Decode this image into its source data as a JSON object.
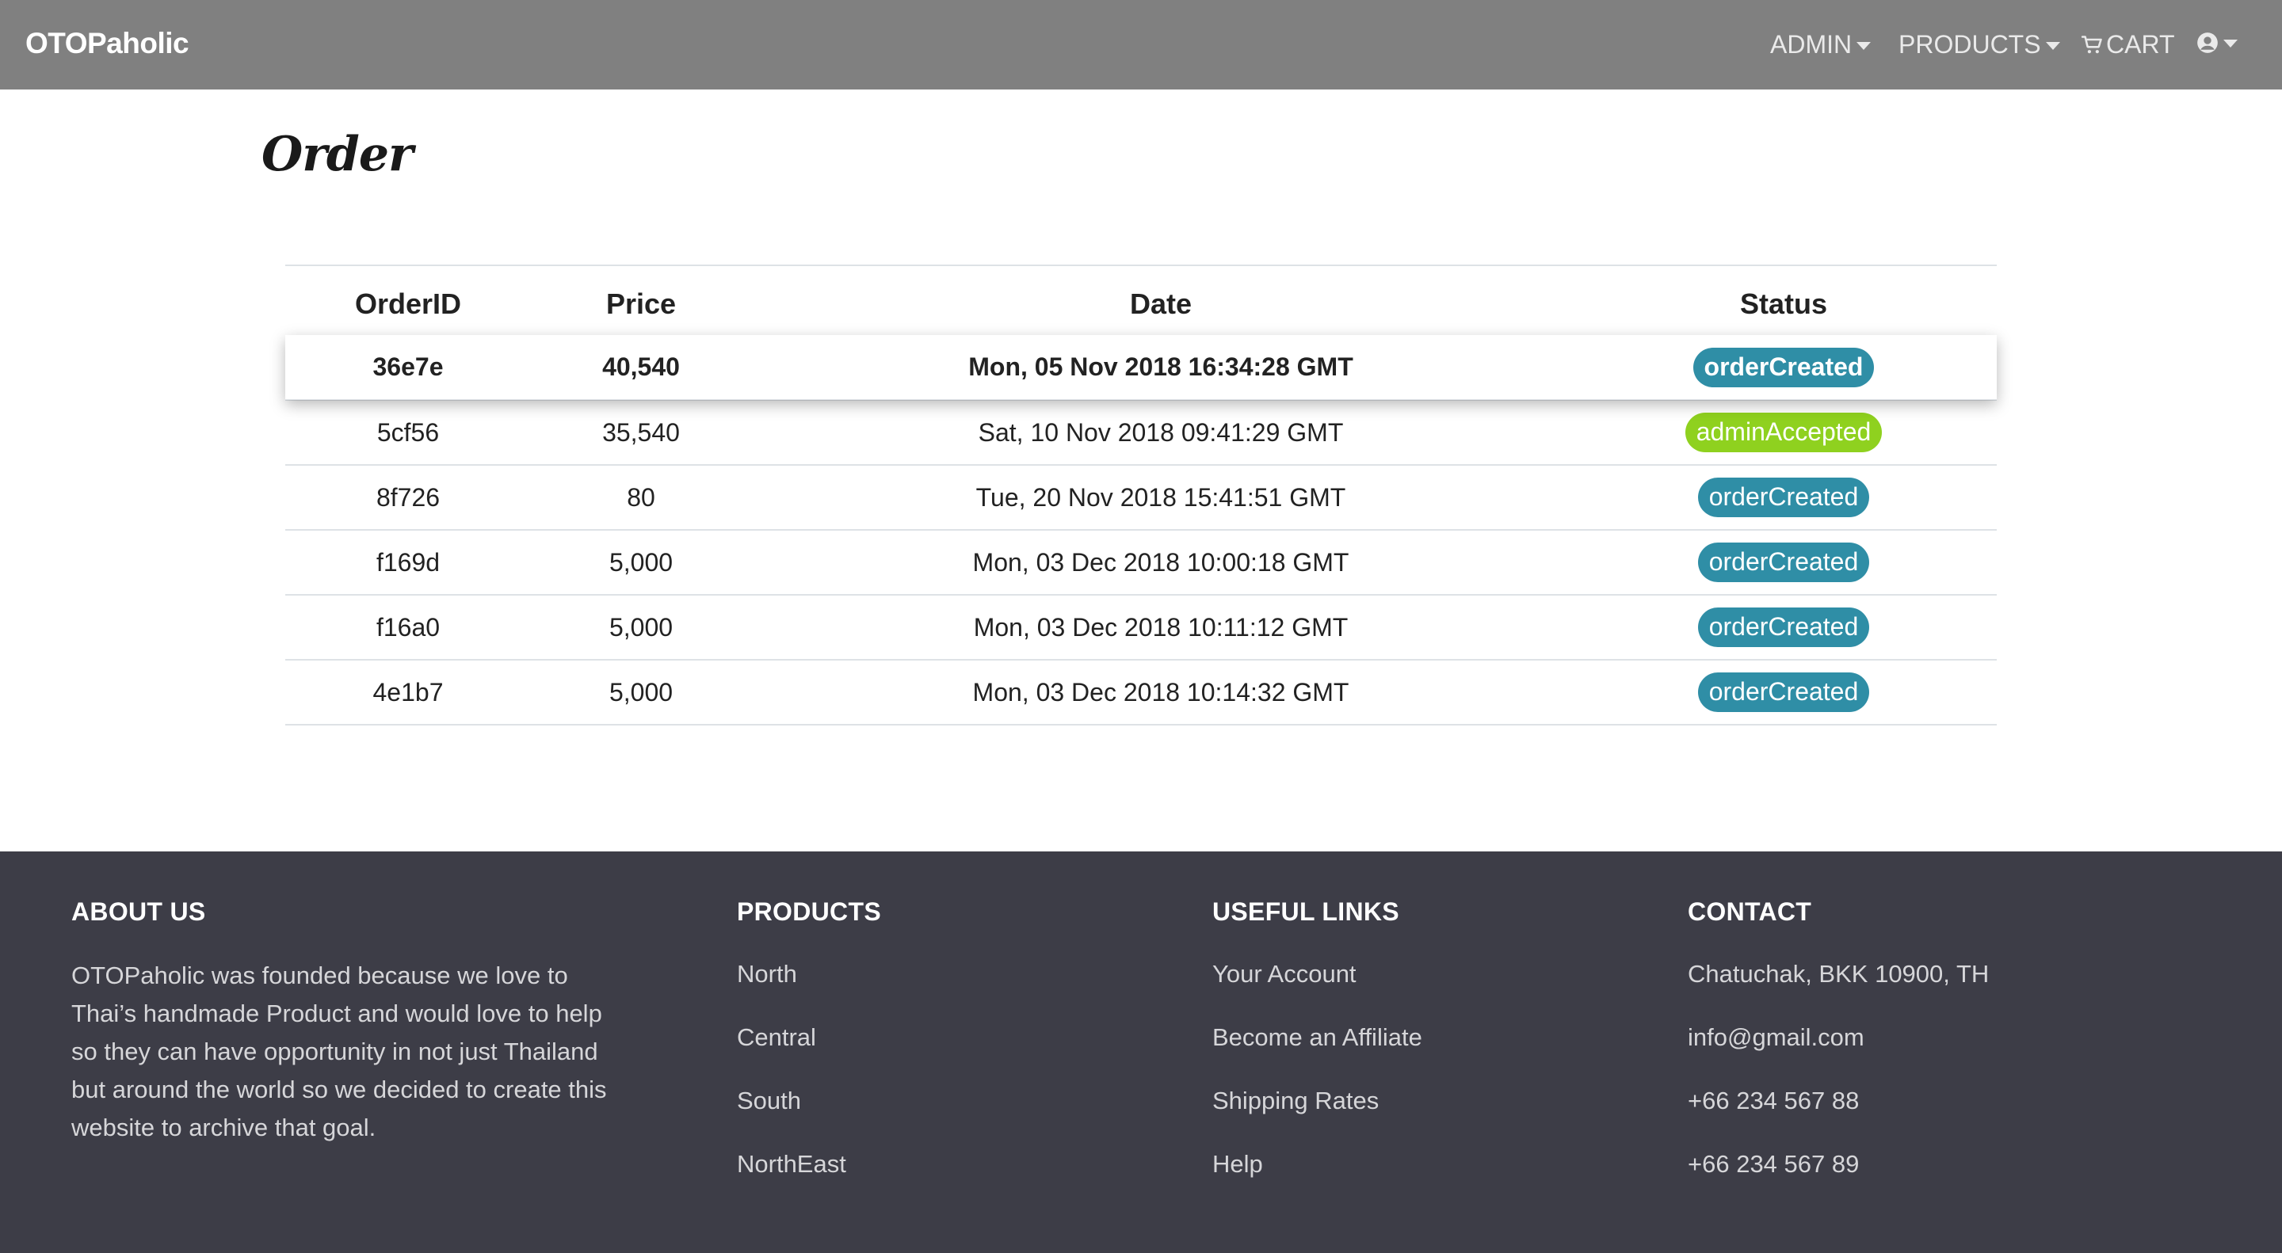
{
  "navbar": {
    "brand": "OTOPaholic",
    "admin_label": "ADMIN",
    "products_label": "PRODUCTS",
    "cart_label": "CART"
  },
  "page": {
    "title": "Order"
  },
  "table": {
    "headers": {
      "id": "OrderID",
      "price": "Price",
      "date": "Date",
      "status": "Status"
    },
    "rows": [
      {
        "id": "36e7e",
        "price": "40,540",
        "date": "Mon, 05 Nov 2018 16:34:28 GMT",
        "status": "orderCreated"
      },
      {
        "id": "5cf56",
        "price": "35,540",
        "date": "Sat, 10 Nov 2018 09:41:29 GMT",
        "status": "adminAccepted"
      },
      {
        "id": "8f726",
        "price": "80",
        "date": "Tue, 20 Nov 2018 15:41:51 GMT",
        "status": "orderCreated"
      },
      {
        "id": "f169d",
        "price": "5,000",
        "date": "Mon, 03 Dec 2018 10:00:18 GMT",
        "status": "orderCreated"
      },
      {
        "id": "f16a0",
        "price": "5,000",
        "date": "Mon, 03 Dec 2018 10:11:12 GMT",
        "status": "orderCreated"
      },
      {
        "id": "4e1b7",
        "price": "5,000",
        "date": "Mon, 03 Dec 2018 10:14:32 GMT",
        "status": "orderCreated"
      }
    ]
  },
  "footer": {
    "about": {
      "heading": "ABOUT US",
      "text": "OTOPaholic was founded because we love to Thai’s handmade Product and would love to help so they can have opportunity in not just Thailand but around the world so we decided to create this website to archive that goal."
    },
    "products": {
      "heading": "PRODUCTS",
      "items": [
        "North",
        "Central",
        "South",
        "NorthEast"
      ]
    },
    "links": {
      "heading": "USEFUL LINKS",
      "items": [
        "Your Account",
        "Become an Affiliate",
        "Shipping Rates",
        "Help"
      ]
    },
    "contact": {
      "heading": "CONTACT",
      "items": [
        "Chatuchak, BKK 10900, TH",
        "info@gmail.com",
        "+66 234 567 88",
        "+66 234 567 89"
      ]
    }
  },
  "colors": {
    "navbar": "#808080",
    "footer": "#3d3d47",
    "badge_created": "#2f8ea6",
    "badge_accepted": "#8fd11f"
  },
  "icons": {
    "cart": "cart-icon",
    "user": "user-circle-icon",
    "caret": "caret-down-icon"
  }
}
